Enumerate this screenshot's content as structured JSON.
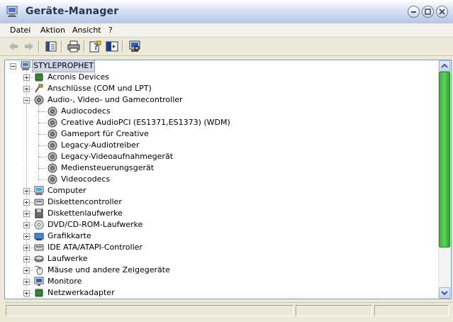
{
  "window": {
    "title": "Geräte-Manager"
  },
  "menubar": {
    "items": [
      "Datei",
      "Aktion",
      "Ansicht",
      "?"
    ]
  },
  "toolbar": {
    "buttons": [
      "back-icon",
      "forward-icon",
      "show-hide-tree-icon",
      "print-icon",
      "properties-icon",
      "help-icon",
      "scan-hardware-icon"
    ]
  },
  "tree": {
    "root": {
      "label": "STYLEPROPHET",
      "icon": "computer-icon"
    },
    "items": [
      {
        "label": "Acronis Devices",
        "icon": "chip-icon",
        "expanded": false
      },
      {
        "label": "Anschlüsse (COM und LPT)",
        "icon": "port-icon",
        "expanded": false
      },
      {
        "label": "Audio-, Video- und Gamecontroller",
        "icon": "speaker-icon",
        "expanded": true,
        "children": [
          "Audiocodecs",
          "Creative AudioPCI (ES1371,ES1373) (WDM)",
          "Gameport für Creative",
          "Legacy-Audiotreiber",
          "Legacy-Videoaufnahmegerät",
          "Mediensteuerungsgerät",
          "Videocodecs"
        ]
      },
      {
        "label": "Computer",
        "icon": "computer-icon",
        "expanded": false
      },
      {
        "label": "Diskettencontroller",
        "icon": "controller-icon",
        "expanded": false
      },
      {
        "label": "Diskettenlaufwerke",
        "icon": "floppy-icon",
        "expanded": false
      },
      {
        "label": "DVD/CD-ROM-Laufwerke",
        "icon": "cd-icon",
        "expanded": false
      },
      {
        "label": "Grafikkarte",
        "icon": "display-adapter-icon",
        "expanded": false
      },
      {
        "label": "IDE ATA/ATAPI-Controller",
        "icon": "controller-icon",
        "expanded": false
      },
      {
        "label": "Laufwerke",
        "icon": "disk-icon",
        "expanded": false
      },
      {
        "label": "Mäuse und andere Zeigegeräte",
        "icon": "mouse-icon",
        "expanded": false
      },
      {
        "label": "Monitore",
        "icon": "monitor-icon",
        "expanded": false
      },
      {
        "label": "Netzwerkadapter",
        "icon": "chip-icon",
        "expanded": false
      }
    ]
  },
  "colors": {
    "tree_lines": "#a0a0a0",
    "scroll_thumb": "#3cb33c",
    "window_bg": "#ece9d8"
  }
}
